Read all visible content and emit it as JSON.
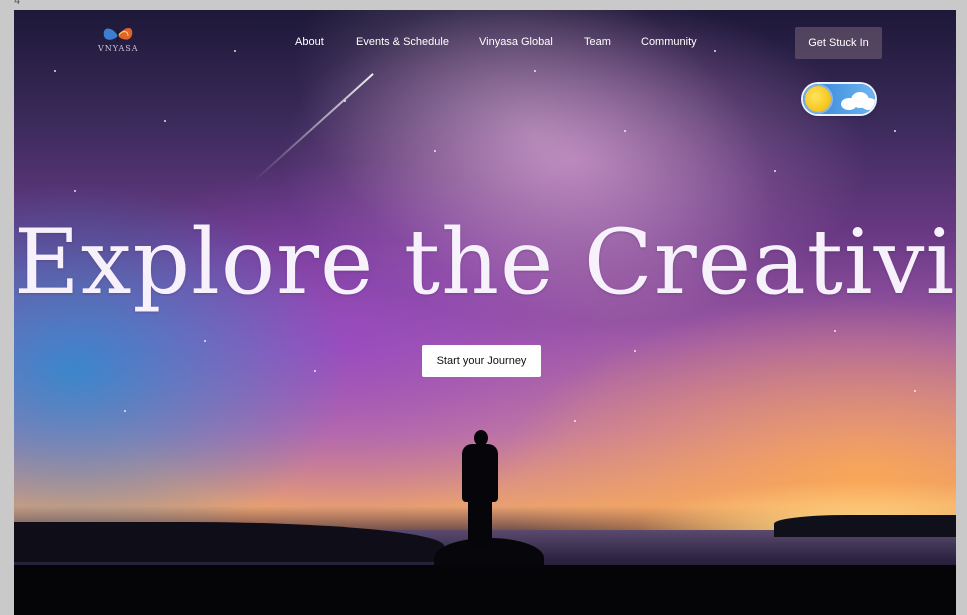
{
  "frame": {
    "label": "4"
  },
  "brand": {
    "logo_text": "VNYASA"
  },
  "nav": {
    "items": [
      {
        "label": "About"
      },
      {
        "label": "Events & Schedule"
      },
      {
        "label": "Vinyasa Global"
      },
      {
        "label": "Team"
      },
      {
        "label": "Community"
      }
    ]
  },
  "header": {
    "cta_label": "Get Stuck In"
  },
  "theme_toggle": {
    "state": "day",
    "icon": "sun-icon"
  },
  "hero": {
    "headline": "Explore the Creativity",
    "cta_label": "Start your Journey"
  },
  "colors": {
    "headline": "#f7f1fb",
    "cta_bg": "#ffffff",
    "toggle_bg": "#2f7fd6",
    "sun": "#f2b600"
  }
}
